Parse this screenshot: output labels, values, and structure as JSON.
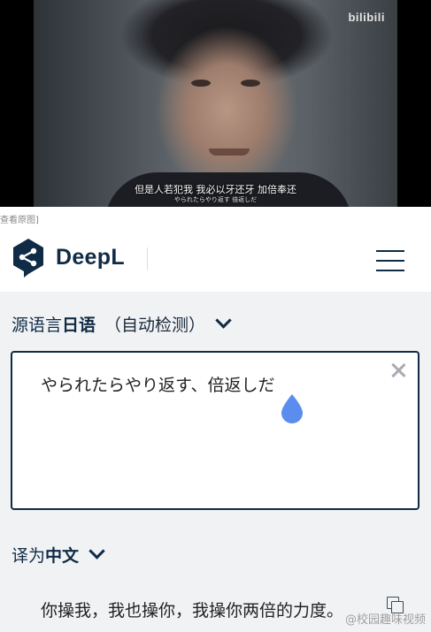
{
  "video": {
    "logo": "bilibili",
    "subtitle_main": "但是人若犯我  我必以牙还牙  加倍奉还",
    "subtitle_jp": "やられたらやり返す  倍返しだ"
  },
  "view_original": "查看原图]",
  "header": {
    "brand": "DeepL",
    "menu_icon": "hamburger-menu-icon",
    "colors": {
      "brand": "#0f2b46"
    }
  },
  "translator": {
    "source_lang": {
      "prefix": "源语言",
      "language": "日语",
      "detect": "（自动检测）"
    },
    "source_text": "やられたらやり返す、倍返しだ",
    "target_lang": {
      "prefix": "译为",
      "language": "中文"
    },
    "target_text": "你操我，我也操你，我操你两倍的力度。",
    "colors": {
      "panel": "#f1f2f4",
      "drag_handle": "#5b8def"
    }
  },
  "watermark": "@校园趣味视频"
}
